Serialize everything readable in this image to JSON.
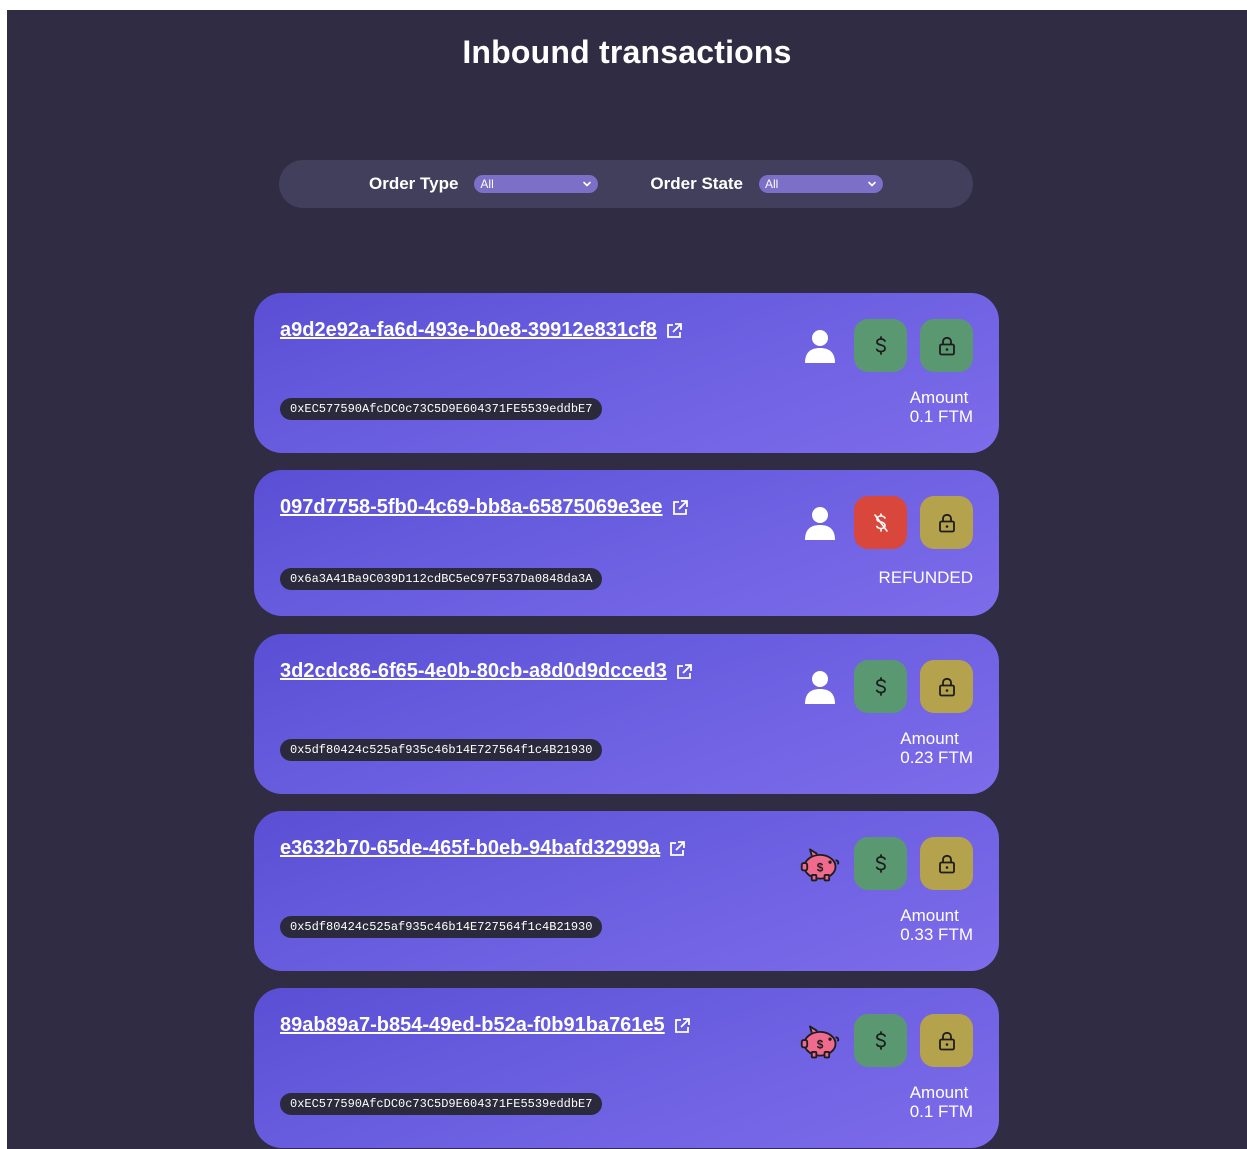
{
  "page": {
    "title": "Inbound transactions"
  },
  "filters": {
    "order_type": {
      "label": "Order Type",
      "selected": "All"
    },
    "order_state": {
      "label": "Order State",
      "selected": "All"
    }
  },
  "colors": {
    "background": "#2f2c43",
    "filter_bar": "#423f5d",
    "card_gradient_start": "#5a4fd4",
    "card_gradient_end": "#7d6cea",
    "paid_green": "#5a9872",
    "refund_red": "#d9473c",
    "lock_olive": "#b5a24c",
    "address_pill": "#2b2a3d"
  },
  "transactions": [
    {
      "id": "a9d2e92a-fa6d-493e-b0e8-39912e831cf8",
      "address": "0xEC577590AfcDC0c73C5D9E604371FE5539eddbE7",
      "type_icon": "user-icon",
      "payment_icon": "dollar-icon",
      "payment_status": "paid",
      "lock_icon": "lock-icon",
      "lock_status": "green",
      "amount_label": "Amount",
      "amount": "0.1 FTM",
      "state_text": ""
    },
    {
      "id": "097d7758-5fb0-4c69-bb8a-65875069e3ee",
      "address": "0x6a3A41Ba9C039D112cdBC5eC97F537Da0848da3A",
      "type_icon": "user-icon",
      "payment_icon": "dollar-off-icon",
      "payment_status": "refunded",
      "lock_icon": "lock-icon",
      "lock_status": "olive",
      "amount_label": "",
      "amount": "",
      "state_text": "REFUNDED"
    },
    {
      "id": "3d2cdc86-6f65-4e0b-80cb-a8d0d9dcced3",
      "address": "0x5df80424c525af935c46b14E727564f1c4B21930",
      "type_icon": "user-icon",
      "payment_icon": "dollar-icon",
      "payment_status": "paid",
      "lock_icon": "lock-icon",
      "lock_status": "olive",
      "amount_label": "Amount",
      "amount": "0.23 FTM",
      "state_text": ""
    },
    {
      "id": "e3632b70-65de-465f-b0eb-94bafd32999a",
      "address": "0x5df80424c525af935c46b14E727564f1c4B21930",
      "type_icon": "piggy-bank-icon",
      "payment_icon": "dollar-icon",
      "payment_status": "paid",
      "lock_icon": "lock-icon",
      "lock_status": "olive",
      "amount_label": "Amount",
      "amount": "0.33 FTM",
      "state_text": ""
    },
    {
      "id": "89ab89a7-b854-49ed-b52a-f0b91ba761e5",
      "address": "0xEC577590AfcDC0c73C5D9E604371FE5539eddbE7",
      "type_icon": "piggy-bank-icon",
      "payment_icon": "dollar-icon",
      "payment_status": "paid",
      "lock_icon": "lock-icon",
      "lock_status": "olive",
      "amount_label": "Amount",
      "amount": "0.1 FTM",
      "state_text": ""
    }
  ]
}
